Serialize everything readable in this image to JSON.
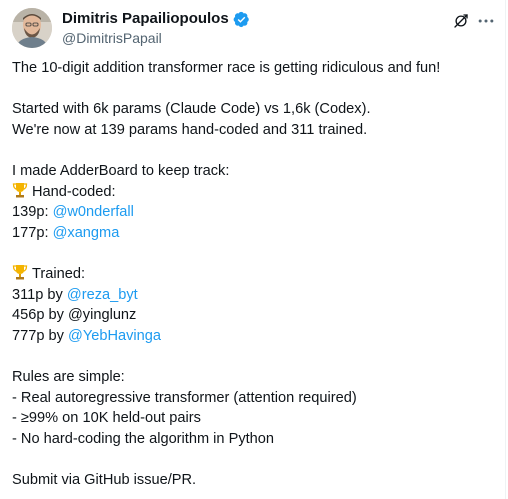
{
  "header": {
    "display_name": "Dimitris Papailiopoulos",
    "handle": "@DimitrisPapail",
    "verified_icon": "verified-badge-icon",
    "grok_icon": "grok-icon",
    "more_icon": "more-horizontal-icon",
    "accent_color": "#1d9bf0"
  },
  "tweet": {
    "line1": "The 10-digit addition transformer race is getting ridiculous and fun!",
    "line2": "Started with 6k params (Claude Code) vs 1,6k (Codex).",
    "line3": "We're now at 139 params hand-coded and 311 trained.",
    "line4": "I made AdderBoard to keep track:",
    "hand_coded_label": "Hand-coded:",
    "hc1_prefix": "139p: ",
    "hc1_mention": "@w0nderfall",
    "hc2_prefix": "177p: ",
    "hc2_mention": "@xangma",
    "trained_label": "Trained:",
    "tr1_prefix": "311p by ",
    "tr1_mention": "@reza_byt",
    "tr2_text": "456p by @yinglunz",
    "tr3_prefix": "777p by ",
    "tr3_mention": "@YebHavinga",
    "rules_title": "Rules are simple:",
    "rule1": "- Real autoregressive transformer (attention required)",
    "rule2": "- ≥99% on 10K held-out pairs",
    "rule3": "- No hard-coding the algorithm in Python",
    "submit": "Submit via GitHub issue/PR."
  }
}
